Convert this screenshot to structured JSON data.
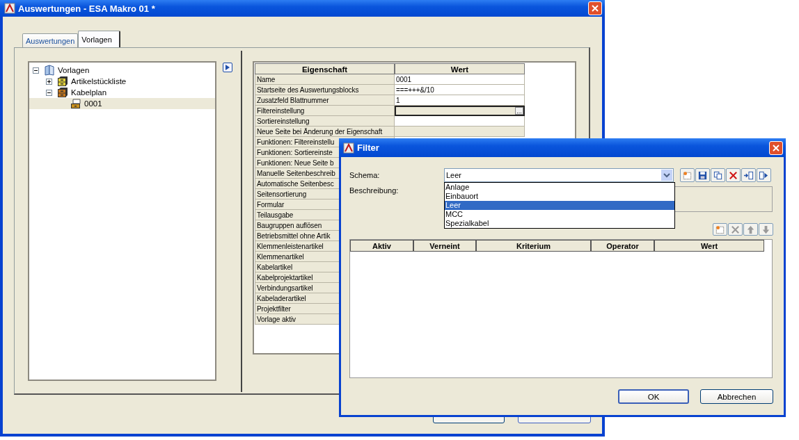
{
  "window": {
    "title": "Auswertungen - ESA Makro 01 *"
  },
  "tabs": [
    {
      "label": "Auswertungen",
      "selected": false
    },
    {
      "label": "Vorlagen",
      "selected": true
    }
  ],
  "tree": [
    {
      "label": "Vorlagen",
      "kind": "root",
      "expanded": true,
      "selected": false,
      "children": [
        {
          "label": "Artikelstückliste",
          "kind": "folder",
          "color": "#e2d23a",
          "expanded": false,
          "selected": false
        },
        {
          "label": "Kabelplan",
          "kind": "folder",
          "color": "#c7781e",
          "expanded": true,
          "selected": false,
          "children": [
            {
              "label": "0001",
              "kind": "item",
              "selected": true
            }
          ]
        }
      ]
    }
  ],
  "properties": {
    "columns": [
      "Eigenschaft",
      "Wert"
    ],
    "rows": [
      {
        "name": "Name",
        "value": "0001",
        "kind": "editable",
        "selected": false
      },
      {
        "name": "Startseite des Auswertungsblocks",
        "value": "===+++&/10",
        "kind": "editable",
        "selected": false
      },
      {
        "name": "Zusatzfeld Blattnummer",
        "value": "1",
        "kind": "editable",
        "selected": false
      },
      {
        "name": "Filtereinstellung",
        "kind": "editable",
        "button": "...",
        "selected": true
      },
      {
        "name": "Sortiereinstellung",
        "kind": "editable",
        "selected": false
      },
      {
        "name": "Neue Seite bei Änderung der Eigenschaft",
        "kind": "readonly",
        "selected": false
      },
      {
        "name": "Funktionen: Filtereinstellu"
      },
      {
        "name": "Funktionen: Sortiereinste"
      },
      {
        "name": "Funktionen: Neue Seite b"
      },
      {
        "name": "Manuelle Seitenbeschreib"
      },
      {
        "name": "Automatische Seitenbesc"
      },
      {
        "name": "Seitensortierung"
      },
      {
        "name": "Formular"
      },
      {
        "name": "Teilausgabe"
      },
      {
        "name": "Baugruppen auflösen"
      },
      {
        "name": "Betriebsmittel ohne Artik"
      },
      {
        "name": "Klemmenleistenartikel"
      },
      {
        "name": "Klemmenartikel"
      },
      {
        "name": "Kabelartikel"
      },
      {
        "name": "Kabelprojektartikel"
      },
      {
        "name": "Verbindungsartikel"
      },
      {
        "name": "Kabeladerartikel"
      },
      {
        "name": "Projektfilter"
      },
      {
        "name": "Vorlage aktiv"
      }
    ]
  },
  "filter_dialog": {
    "title": "Filter",
    "schema": {
      "label": "Schema:",
      "value": "Leer",
      "expanded": true,
      "options": [
        {
          "label": "Anlage",
          "selected": false
        },
        {
          "label": "Einbauort",
          "selected": false
        },
        {
          "label": "Leer",
          "selected": true
        },
        {
          "label": "MCC",
          "selected": false
        },
        {
          "label": "Spezialkabel",
          "selected": false
        }
      ]
    },
    "toolbar": [
      {
        "kind": "new",
        "disabled": false
      },
      {
        "kind": "save",
        "disabled": false
      },
      {
        "kind": "copy",
        "disabled": false
      },
      {
        "kind": "delete",
        "disabled": false
      },
      {
        "kind": "import",
        "disabled": false
      },
      {
        "kind": "export",
        "disabled": false
      }
    ],
    "description_label": "Beschreibung:",
    "criteria_toolbar": [
      {
        "kind": "new",
        "disabled": false
      },
      {
        "kind": "delete",
        "disabled": true
      },
      {
        "kind": "up",
        "disabled": true
      },
      {
        "kind": "down",
        "disabled": true
      }
    ],
    "columns": [
      "Aktiv",
      "Verneint",
      "Kriterium",
      "Operator",
      "Wert"
    ],
    "buttons": [
      {
        "label": "OK",
        "default": true
      },
      {
        "label": "Abbrechen",
        "default": false
      }
    ]
  }
}
